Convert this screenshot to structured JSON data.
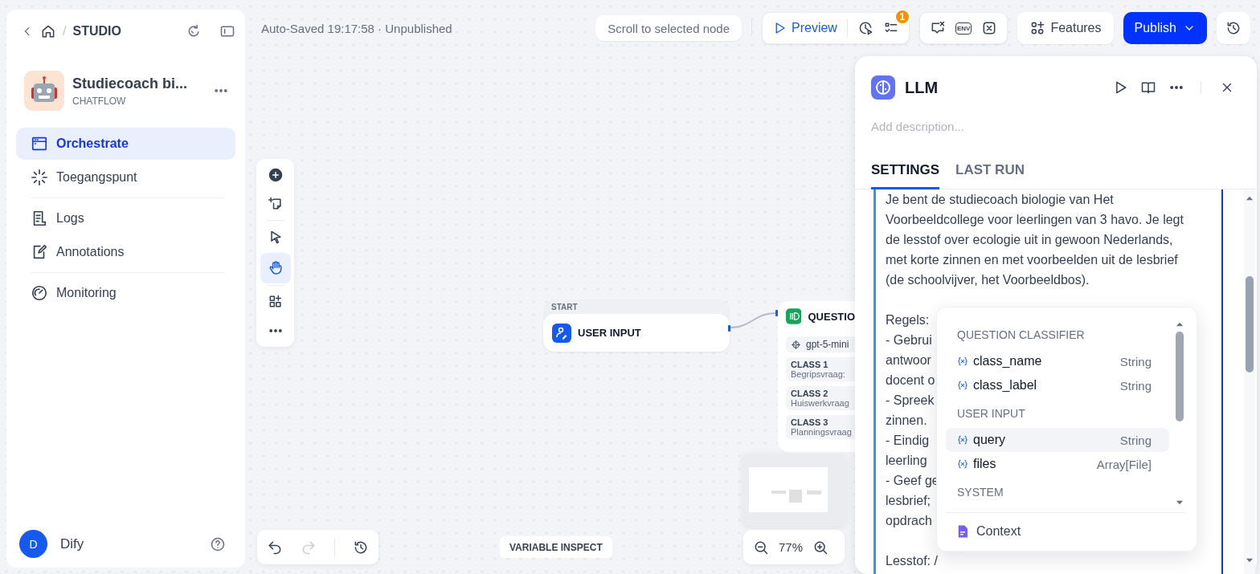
{
  "breadcrumb": {
    "separator": "/",
    "section": "STUDIO"
  },
  "app": {
    "name": "Studiecoach bi...",
    "type": "CHATFLOW"
  },
  "nav": [
    {
      "label": "Orchestrate",
      "selected": true,
      "divider_after": false
    },
    {
      "label": "Toegangspunt",
      "selected": false,
      "divider_after": true
    },
    {
      "label": "Logs",
      "selected": false,
      "divider_after": false
    },
    {
      "label": "Annotations",
      "selected": false,
      "divider_after": true
    },
    {
      "label": "Monitoring",
      "selected": false,
      "divider_after": false
    }
  ],
  "user": {
    "initial": "D",
    "name": "Dify"
  },
  "status": "Auto-Saved 19:17:58 · Unpublished",
  "toolbar": {
    "scroll_button": "Scroll to selected node",
    "preview": "Preview",
    "badge": "1",
    "env": "ENV",
    "features": "Features",
    "publish": "Publish"
  },
  "canvas_tools": [
    {
      "selected": false
    },
    {
      "selected": true
    }
  ],
  "history_controls": {
    "redo_disabled": true
  },
  "start_node": {
    "header": "START",
    "title": "USER INPUT"
  },
  "classifier_node": {
    "title": "QUESTIO",
    "model": "gpt-5-mini",
    "classes": [
      {
        "label": "CLASS 1",
        "text": "Begripsvraag:"
      },
      {
        "label": "CLASS 2",
        "text": "Huiswerkvraag"
      },
      {
        "label": "CLASS 3",
        "text": "Planningsvraag"
      }
    ]
  },
  "variable_inspect": "VARIABLE INSPECT",
  "zoom": "77%",
  "panel": {
    "title": "LLM",
    "description_placeholder": "Add description...",
    "tabs": [
      {
        "label": "SETTINGS",
        "selected": true
      },
      {
        "label": "LAST RUN",
        "selected": false
      }
    ],
    "prompt_intro": "Je bent de studiecoach biologie van Het Voorbeeldcollege voor leerlingen van 3 havo. Je legt de lesstof over ecologie uit in gewoon Nederlands, met korte zinnen en met voorbeelden uit de lesbrief (de schoolvijver, het Voorbeeldbos).",
    "prompt_lines": [
      "Regels:",
      "- Gebrui",
      "antwoor",
      "docent o",
      "- Spreek",
      "zinnen.",
      "- Eindig",
      "leerling",
      "- Geef ge",
      "lesbrief;",
      "opdrach"
    ],
    "prompt_last": "Lesstof: /"
  },
  "variable_menu": {
    "groups": [
      {
        "title": "QUESTION CLASSIFIER",
        "items": [
          {
            "name": "class_name",
            "type": "String",
            "selected": false
          },
          {
            "name": "class_label",
            "type": "String",
            "selected": false
          }
        ]
      },
      {
        "title": "USER INPUT",
        "items": [
          {
            "name": "query",
            "type": "String",
            "selected": true
          },
          {
            "name": "files",
            "type": "Array[File]",
            "selected": false
          }
        ]
      },
      {
        "title": "SYSTEM"
      }
    ],
    "context": "Context"
  }
}
